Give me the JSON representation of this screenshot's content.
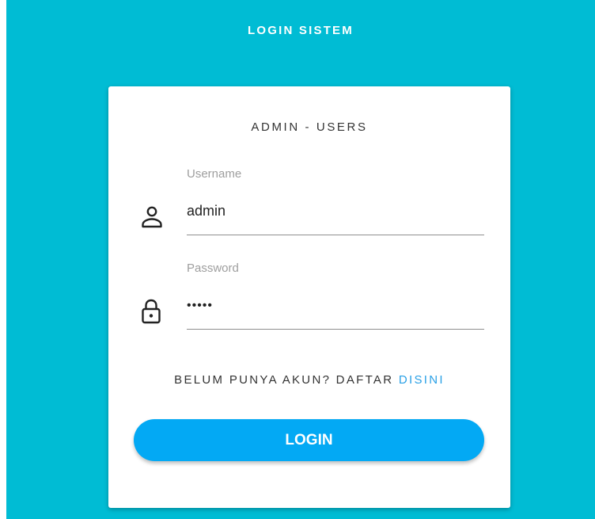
{
  "header": {
    "title": "LOGIN SISTEM"
  },
  "card": {
    "title": "ADMIN - USERS"
  },
  "form": {
    "username": {
      "label": "Username",
      "value": "admin",
      "icon": "user-icon"
    },
    "password": {
      "label": "Password",
      "value": "admin",
      "icon": "lock-icon"
    },
    "register_prompt": "BELUM PUNYA AKUN? DAFTAR",
    "register_link": "DISINI",
    "submit_label": "LOGIN"
  },
  "colors": {
    "background": "#00bcd4",
    "card": "#ffffff",
    "button": "#03a9f4",
    "link": "#29a0e6"
  }
}
